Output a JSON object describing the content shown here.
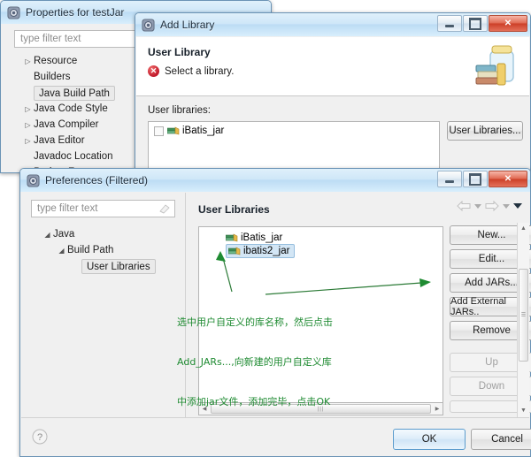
{
  "background": {
    "desktop_color": "#ffffff"
  },
  "windows": {
    "properties": {
      "title": "Properties for testJar",
      "icon": "eclipse-properties-icon",
      "filter": {
        "placeholder": "type filter text",
        "value": ""
      },
      "tree": [
        {
          "label": "Resource",
          "twisty": "collapsed",
          "selected": false
        },
        {
          "label": "Builders",
          "twisty": "none",
          "selected": false
        },
        {
          "label": "Java Build Path",
          "twisty": "none",
          "selected": true
        },
        {
          "label": "Java Code Style",
          "twisty": "collapsed",
          "selected": false
        },
        {
          "label": "Java Compiler",
          "twisty": "collapsed",
          "selected": false
        },
        {
          "label": "Java Editor",
          "twisty": "collapsed",
          "selected": false
        },
        {
          "label": "Javadoc Location",
          "twisty": "none",
          "selected": false
        },
        {
          "label": "Project Facets",
          "twisty": "none",
          "selected": false
        }
      ]
    },
    "add_library": {
      "title": "Add Library",
      "icon": "eclipse-wizard-icon",
      "header_title": "User Library",
      "header_message": "Select a library.",
      "header_icon": "error-icon",
      "banner_icon": "jar-library-banner-icon",
      "list_label": "User libraries:",
      "items": [
        {
          "label": "iBatis_jar",
          "checked": false,
          "icon": "jar-library-icon"
        }
      ],
      "side_button": "User Libraries...",
      "window_buttons": [
        "minimize",
        "maximize",
        "close"
      ]
    },
    "preferences": {
      "title": "Preferences (Filtered)",
      "icon": "eclipse-preferences-icon",
      "filter": {
        "placeholder": "type filter text",
        "value": ""
      },
      "tree": [
        {
          "label": "Java",
          "twisty": "expanded",
          "indent": 0,
          "selected": false
        },
        {
          "label": "Build Path",
          "twisty": "expanded",
          "indent": 1,
          "selected": false
        },
        {
          "label": "User Libraries",
          "twisty": "none",
          "indent": 2,
          "selected": true
        }
      ],
      "page_title": "User Libraries",
      "nav_icons": [
        "back-arrow-icon",
        "back-dropdown-icon",
        "forward-arrow-icon",
        "forward-dropdown-icon",
        "view-menu-icon"
      ],
      "list_items": [
        {
          "label": "iBatis_jar",
          "selected": false,
          "icon": "jar-library-icon"
        },
        {
          "label": "ibatis2_jar",
          "selected": true,
          "icon": "jar-library-icon"
        }
      ],
      "buttons": [
        {
          "label": "New...",
          "mnemonic": "N",
          "enabled": true
        },
        {
          "label": "Edit...",
          "mnemonic": "E",
          "enabled": true
        },
        {
          "label": "Add JARs...",
          "mnemonic": "J",
          "enabled": true
        },
        {
          "label": "Add External JARs..",
          "mnemonic": "x",
          "enabled": true
        },
        {
          "label": "Remove",
          "mnemonic": "R",
          "enabled": true
        },
        {
          "label": "Up",
          "mnemonic": "U",
          "enabled": false
        },
        {
          "label": "Down",
          "mnemonic": "o",
          "enabled": false
        }
      ],
      "footer": {
        "help_icon": "help-question-icon",
        "ok_label": "OK",
        "cancel_label": "Cancel"
      },
      "window_buttons": [
        "minimize",
        "maximize",
        "close"
      ]
    }
  },
  "annotation": {
    "color": "#1f8b32",
    "line1": "选中用户自定义的库名称，然后点击",
    "line2": "Add_JARs...,向新建的用户自定义库",
    "line3": "中添加jar文件，添加完毕，点击OK",
    "arrow_to_list": "arrow-pointing-to-ibatis2-jar",
    "arrow_to_button": "arrow-pointing-to-add-jars-button"
  }
}
